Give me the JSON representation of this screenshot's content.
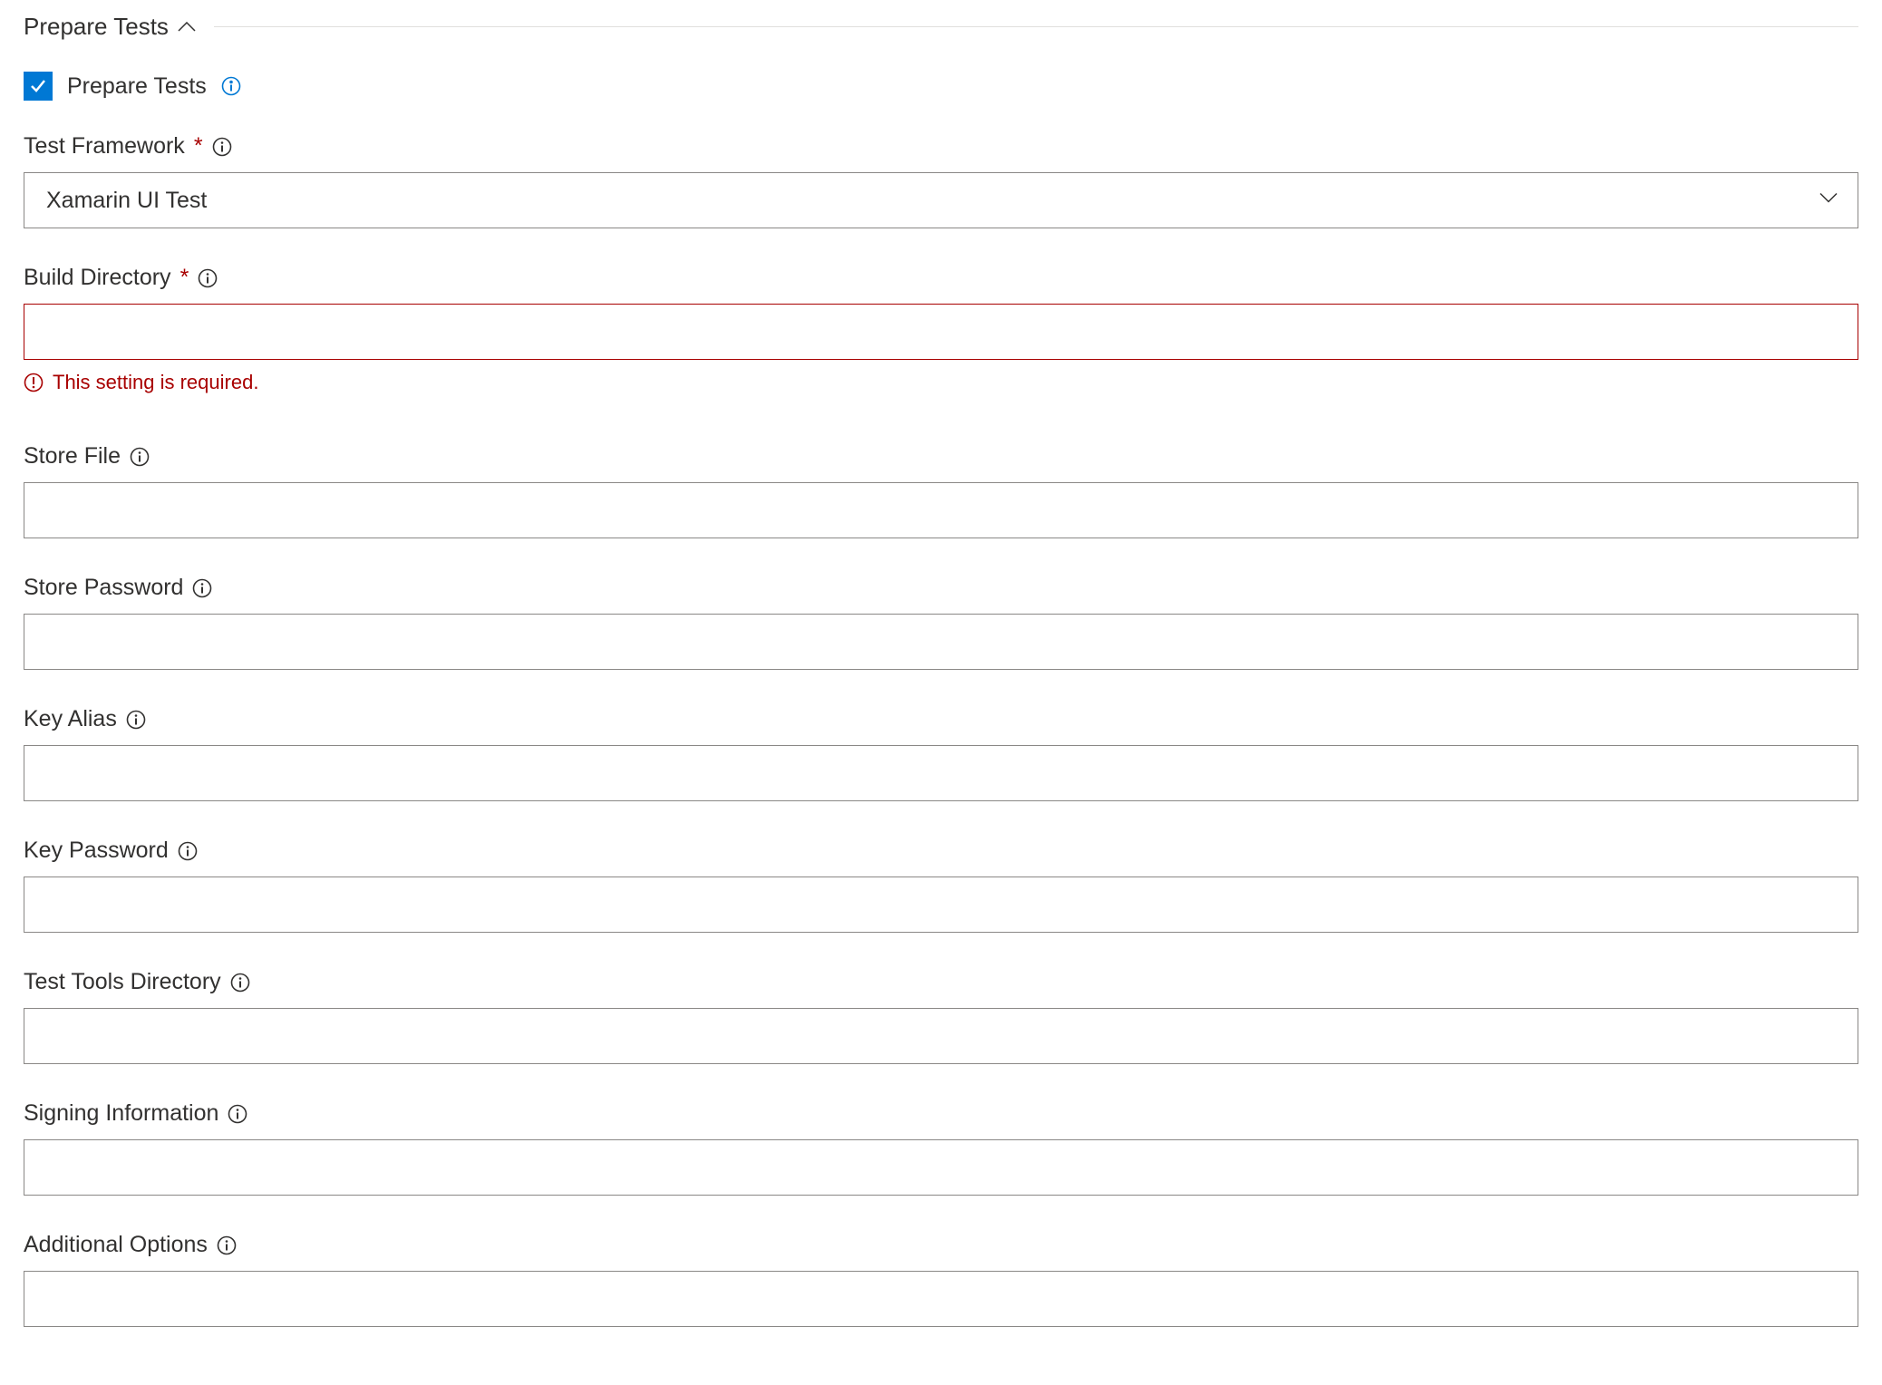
{
  "section": {
    "title": "Prepare Tests"
  },
  "prepare_tests_checkbox": {
    "label": "Prepare Tests",
    "checked": true
  },
  "fields": {
    "test_framework": {
      "label": "Test Framework",
      "required": true,
      "value": "Xamarin UI Test"
    },
    "build_directory": {
      "label": "Build Directory",
      "required": true,
      "value": "",
      "error": "This setting is required."
    },
    "store_file": {
      "label": "Store File",
      "required": false,
      "value": ""
    },
    "store_password": {
      "label": "Store Password",
      "required": false,
      "value": ""
    },
    "key_alias": {
      "label": "Key Alias",
      "required": false,
      "value": ""
    },
    "key_password": {
      "label": "Key Password",
      "required": false,
      "value": ""
    },
    "test_tools_directory": {
      "label": "Test Tools Directory",
      "required": false,
      "value": ""
    },
    "signing_information": {
      "label": "Signing Information",
      "required": false,
      "value": ""
    },
    "additional_options": {
      "label": "Additional Options",
      "required": false,
      "value": ""
    }
  }
}
